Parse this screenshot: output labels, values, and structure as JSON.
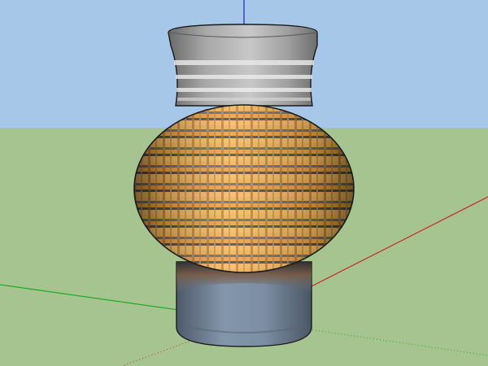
{
  "scene": {
    "sky_color": "#a7c7e8",
    "ground_color": "#a6c490",
    "axes": {
      "blue": "#2222cc",
      "red": "#cc2222",
      "green": "#22aa22"
    },
    "model": {
      "object": "vase",
      "neck_color": "#9a9a9a",
      "neck_band_color": "#dedede",
      "body_base_color": "#d08a2a",
      "body_light_color": "#f2b457",
      "body_stripe_color": "#5a5a64",
      "foot_color": "#6e7e92",
      "foot_top_color": "#8a5a3a",
      "outline_color": "#1a1a1a"
    }
  }
}
